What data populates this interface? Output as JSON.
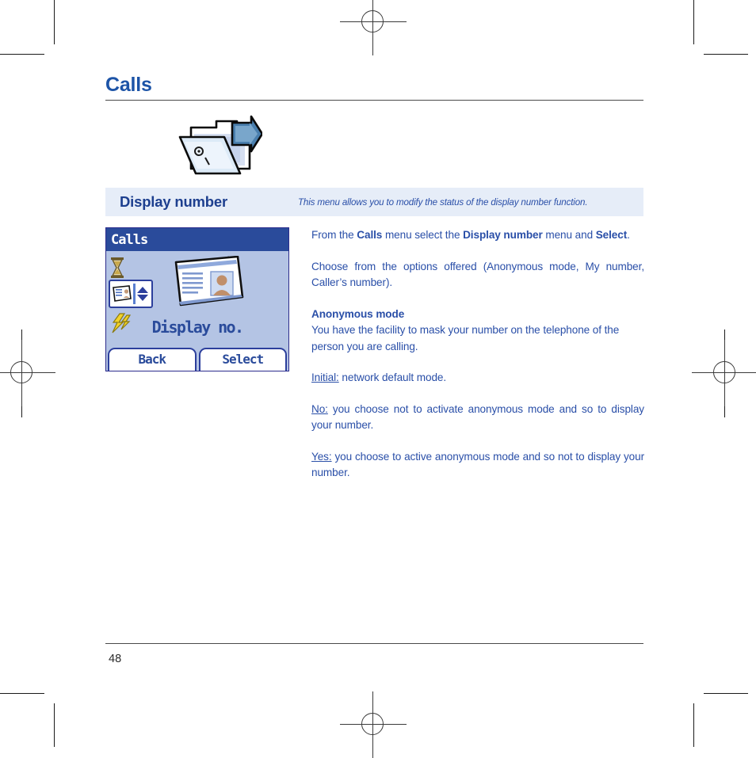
{
  "document": {
    "chapter_title": "Calls",
    "page_number": "48"
  },
  "chapter_icon": {
    "name": "open-folder-with-arrow-icon"
  },
  "section": {
    "title": "Display number",
    "description": "This menu allows you to modify the status of the display number function."
  },
  "phone_mock": {
    "title_bar": "Calls",
    "menu_label": "Display no.",
    "left_softkey": "Back",
    "right_softkey": "Select",
    "icons": {
      "hourglass": "hourglass-icon",
      "selected_item": "contact-card-icon",
      "lightning": "lightning-bolt-icon",
      "scroll_up": "scroll-up-arrow",
      "scroll_down": "scroll-down-arrow",
      "big": "id-card-portrait-icon"
    }
  },
  "body": {
    "p1": {
      "a": "From the ",
      "b1": "Calls",
      "c": " menu select the ",
      "b2": "Display number",
      "d": " menu and ",
      "b3": "Select",
      "e": "."
    },
    "p2": "Choose from the options offered (Anonymous mode, My number, Caller’s number).",
    "p3": {
      "heading": "Anonymous mode",
      "text": "You have the facility to mask your number on the telephone of the person you are calling."
    },
    "p4": {
      "label": "Initial:",
      "text": " network default mode."
    },
    "p5": {
      "label": "No:",
      "text": " you choose not to activate anonymous mode and so to display your number."
    },
    "p6": {
      "label": "Yes:",
      "text": " you choose to active anonymous mode and so not to display your number."
    }
  },
  "colors": {
    "heading_blue": "#1d54a7",
    "body_blue": "#2a4fa8",
    "band_bg": "#e6edf8",
    "phone_bg": "#b4c4e4",
    "phone_titlebar": "#2a4b9b"
  }
}
